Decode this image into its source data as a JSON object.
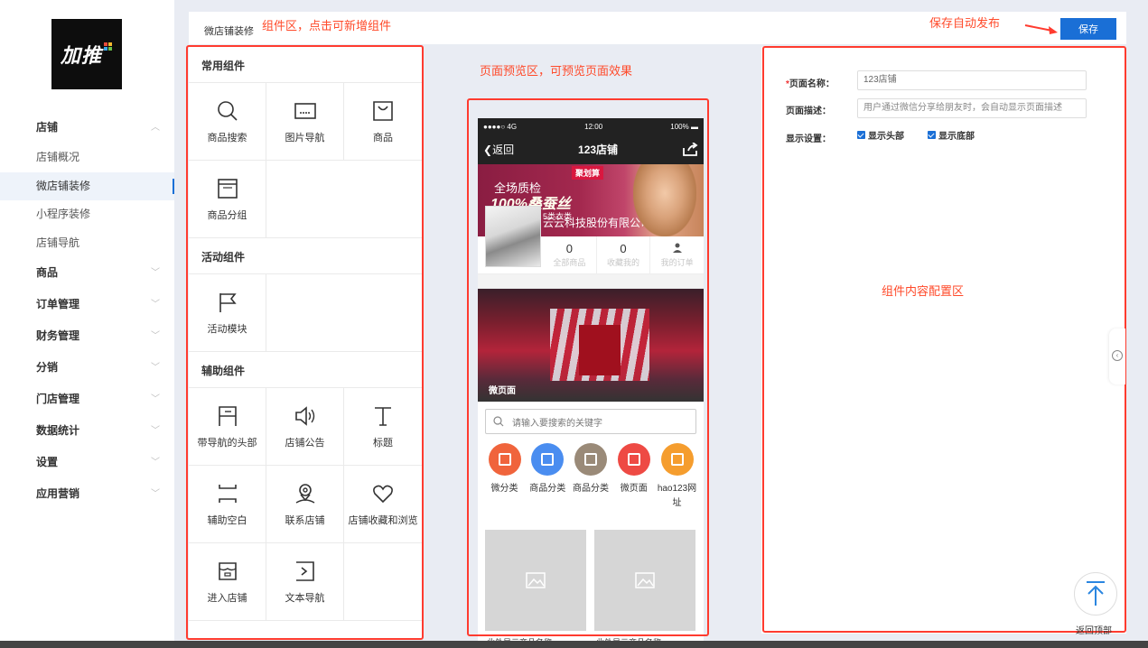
{
  "brand": {
    "logo_text": "加推"
  },
  "sidebar": {
    "items": [
      {
        "label": "店铺",
        "type": "group",
        "chev": "︿"
      },
      {
        "label": "店铺概况",
        "type": "sub"
      },
      {
        "label": "微店铺装修",
        "type": "sub",
        "active": true
      },
      {
        "label": "小程序装修",
        "type": "sub"
      },
      {
        "label": "店铺导航",
        "type": "sub"
      },
      {
        "label": "商品",
        "type": "group",
        "chev": "﹀"
      },
      {
        "label": "订单管理",
        "type": "group",
        "chev": "﹀"
      },
      {
        "label": "财务管理",
        "type": "group",
        "chev": "﹀"
      },
      {
        "label": "分销",
        "type": "group",
        "chev": "﹀"
      },
      {
        "label": "门店管理",
        "type": "group",
        "chev": "﹀"
      },
      {
        "label": "数据统计",
        "type": "group",
        "chev": "﹀"
      },
      {
        "label": "设置",
        "type": "group",
        "chev": "﹀"
      },
      {
        "label": "应用营销",
        "type": "group",
        "chev": "﹀"
      }
    ]
  },
  "header": {
    "breadcrumb": "微店铺装修",
    "save_label": "保存"
  },
  "annotations": {
    "components": "组件区，点击可新增组件",
    "autosave": "保存自动发布",
    "preview": "页面预览区，可预览页面效果",
    "config": "组件内容配置区"
  },
  "components": {
    "common_title": "常用组件",
    "common": [
      {
        "label": "商品搜索",
        "icon": "search-icon"
      },
      {
        "label": "图片导航",
        "icon": "image-nav-icon"
      },
      {
        "label": "商品",
        "icon": "shopping-bag-icon"
      },
      {
        "label": "商品分组",
        "icon": "product-group-icon"
      }
    ],
    "activity_title": "活动组件",
    "activity": [
      {
        "label": "活动模块",
        "icon": "flag-icon"
      }
    ],
    "aux_title": "辅助组件",
    "aux": [
      {
        "label": "带导航的头部",
        "icon": "header-nav-icon"
      },
      {
        "label": "店铺公告",
        "icon": "speaker-icon"
      },
      {
        "label": "标题",
        "icon": "title-icon"
      },
      {
        "label": "辅助空白",
        "icon": "blank-space-icon"
      },
      {
        "label": "联系店铺",
        "icon": "location-pin-icon"
      },
      {
        "label": "店铺收藏和浏览",
        "icon": "heart-icon"
      },
      {
        "label": "进入店铺",
        "icon": "store-icon"
      },
      {
        "label": "文本导航",
        "icon": "text-nav-icon"
      }
    ]
  },
  "phone": {
    "status_left": "●●●●○ 4G",
    "status_time": "12:00",
    "status_right": "100%",
    "back_label": "返回",
    "title": "123店铺",
    "banner_badge": "聚划算",
    "banner_line1": "全场质检",
    "banner_line2": "100%桑蚕丝",
    "banner_line3": "5类衣类",
    "shop_name": "云云科技股份有限公司Abby",
    "stats": [
      {
        "num": "0",
        "label": "全部商品"
      },
      {
        "num": "0",
        "label": "收藏我的"
      },
      {
        "num": "",
        "label": "我的订单"
      }
    ],
    "micro_page_label": "微页面",
    "search_placeholder": "请输入要搜索的关键字",
    "cats": [
      {
        "label": "微分类",
        "color": "#f0643c"
      },
      {
        "label": "商品分类",
        "color": "#4a8df0"
      },
      {
        "label": "商品分类",
        "color": "#9a8a78"
      },
      {
        "label": "微页面",
        "color": "#ee4a44"
      },
      {
        "label": "hao123网址",
        "color": "#f59d2e"
      }
    ],
    "product_names": [
      "此处显示商品名称",
      "此处显示商品名称"
    ]
  },
  "config": {
    "page_name_label": "页面名称：",
    "page_name_value": "123店铺",
    "page_desc_label": "页面描述：",
    "page_desc_placeholder": "用户通过微信分享给朋友时，会自动显示页面描述",
    "display_label": "显示设置：",
    "show_header": "显示头部",
    "show_footer": "显示底部"
  },
  "to_top_label": "返回顶部",
  "colors": {
    "accent": "#1a6fd6",
    "annotation": "#ff3b2f"
  }
}
